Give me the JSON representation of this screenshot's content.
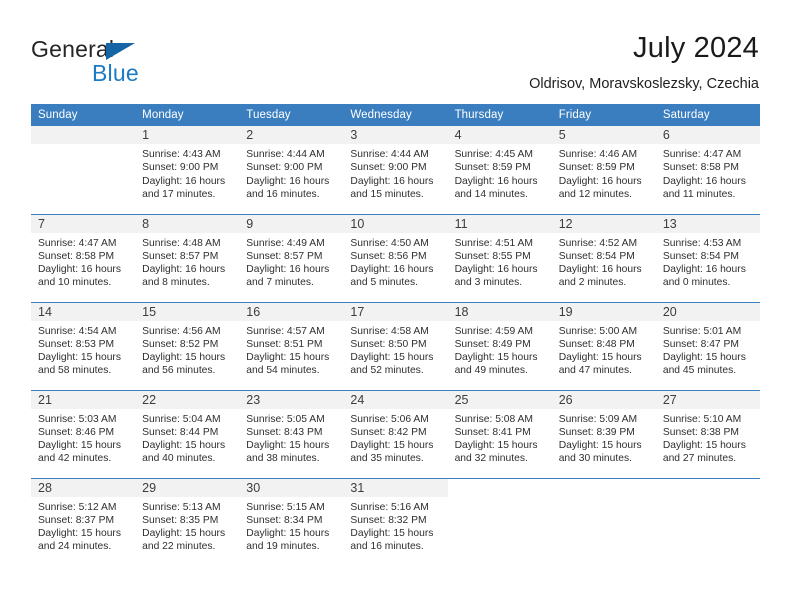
{
  "brand": {
    "word_one": "General",
    "word_two": "Blue",
    "triangle_color": "#1565a6",
    "blue_color": "#1d7bc4"
  },
  "header": {
    "title": "July 2024",
    "subtitle": "Oldrisov, Moravskoslezsky, Czechia"
  },
  "theme": {
    "header_bg": "#3a7ebf",
    "header_text": "#ffffff",
    "daynum_band_bg": "#f2f2f2",
    "row_divider": "#3a7ebf"
  },
  "weekdays": [
    "Sunday",
    "Monday",
    "Tuesday",
    "Wednesday",
    "Thursday",
    "Friday",
    "Saturday"
  ],
  "weeks": [
    [
      {
        "day": "",
        "lines": []
      },
      {
        "day": "1",
        "lines": [
          "Sunrise: 4:43 AM",
          "Sunset: 9:00 PM",
          "Daylight: 16 hours",
          "and 17 minutes."
        ]
      },
      {
        "day": "2",
        "lines": [
          "Sunrise: 4:44 AM",
          "Sunset: 9:00 PM",
          "Daylight: 16 hours",
          "and 16 minutes."
        ]
      },
      {
        "day": "3",
        "lines": [
          "Sunrise: 4:44 AM",
          "Sunset: 9:00 PM",
          "Daylight: 16 hours",
          "and 15 minutes."
        ]
      },
      {
        "day": "4",
        "lines": [
          "Sunrise: 4:45 AM",
          "Sunset: 8:59 PM",
          "Daylight: 16 hours",
          "and 14 minutes."
        ]
      },
      {
        "day": "5",
        "lines": [
          "Sunrise: 4:46 AM",
          "Sunset: 8:59 PM",
          "Daylight: 16 hours",
          "and 12 minutes."
        ]
      },
      {
        "day": "6",
        "lines": [
          "Sunrise: 4:47 AM",
          "Sunset: 8:58 PM",
          "Daylight: 16 hours",
          "and 11 minutes."
        ]
      }
    ],
    [
      {
        "day": "7",
        "lines": [
          "Sunrise: 4:47 AM",
          "Sunset: 8:58 PM",
          "Daylight: 16 hours",
          "and 10 minutes."
        ]
      },
      {
        "day": "8",
        "lines": [
          "Sunrise: 4:48 AM",
          "Sunset: 8:57 PM",
          "Daylight: 16 hours",
          "and 8 minutes."
        ]
      },
      {
        "day": "9",
        "lines": [
          "Sunrise: 4:49 AM",
          "Sunset: 8:57 PM",
          "Daylight: 16 hours",
          "and 7 minutes."
        ]
      },
      {
        "day": "10",
        "lines": [
          "Sunrise: 4:50 AM",
          "Sunset: 8:56 PM",
          "Daylight: 16 hours",
          "and 5 minutes."
        ]
      },
      {
        "day": "11",
        "lines": [
          "Sunrise: 4:51 AM",
          "Sunset: 8:55 PM",
          "Daylight: 16 hours",
          "and 3 minutes."
        ]
      },
      {
        "day": "12",
        "lines": [
          "Sunrise: 4:52 AM",
          "Sunset: 8:54 PM",
          "Daylight: 16 hours",
          "and 2 minutes."
        ]
      },
      {
        "day": "13",
        "lines": [
          "Sunrise: 4:53 AM",
          "Sunset: 8:54 PM",
          "Daylight: 16 hours",
          "and 0 minutes."
        ]
      }
    ],
    [
      {
        "day": "14",
        "lines": [
          "Sunrise: 4:54 AM",
          "Sunset: 8:53 PM",
          "Daylight: 15 hours",
          "and 58 minutes."
        ]
      },
      {
        "day": "15",
        "lines": [
          "Sunrise: 4:56 AM",
          "Sunset: 8:52 PM",
          "Daylight: 15 hours",
          "and 56 minutes."
        ]
      },
      {
        "day": "16",
        "lines": [
          "Sunrise: 4:57 AM",
          "Sunset: 8:51 PM",
          "Daylight: 15 hours",
          "and 54 minutes."
        ]
      },
      {
        "day": "17",
        "lines": [
          "Sunrise: 4:58 AM",
          "Sunset: 8:50 PM",
          "Daylight: 15 hours",
          "and 52 minutes."
        ]
      },
      {
        "day": "18",
        "lines": [
          "Sunrise: 4:59 AM",
          "Sunset: 8:49 PM",
          "Daylight: 15 hours",
          "and 49 minutes."
        ]
      },
      {
        "day": "19",
        "lines": [
          "Sunrise: 5:00 AM",
          "Sunset: 8:48 PM",
          "Daylight: 15 hours",
          "and 47 minutes."
        ]
      },
      {
        "day": "20",
        "lines": [
          "Sunrise: 5:01 AM",
          "Sunset: 8:47 PM",
          "Daylight: 15 hours",
          "and 45 minutes."
        ]
      }
    ],
    [
      {
        "day": "21",
        "lines": [
          "Sunrise: 5:03 AM",
          "Sunset: 8:46 PM",
          "Daylight: 15 hours",
          "and 42 minutes."
        ]
      },
      {
        "day": "22",
        "lines": [
          "Sunrise: 5:04 AM",
          "Sunset: 8:44 PM",
          "Daylight: 15 hours",
          "and 40 minutes."
        ]
      },
      {
        "day": "23",
        "lines": [
          "Sunrise: 5:05 AM",
          "Sunset: 8:43 PM",
          "Daylight: 15 hours",
          "and 38 minutes."
        ]
      },
      {
        "day": "24",
        "lines": [
          "Sunrise: 5:06 AM",
          "Sunset: 8:42 PM",
          "Daylight: 15 hours",
          "and 35 minutes."
        ]
      },
      {
        "day": "25",
        "lines": [
          "Sunrise: 5:08 AM",
          "Sunset: 8:41 PM",
          "Daylight: 15 hours",
          "and 32 minutes."
        ]
      },
      {
        "day": "26",
        "lines": [
          "Sunrise: 5:09 AM",
          "Sunset: 8:39 PM",
          "Daylight: 15 hours",
          "and 30 minutes."
        ]
      },
      {
        "day": "27",
        "lines": [
          "Sunrise: 5:10 AM",
          "Sunset: 8:38 PM",
          "Daylight: 15 hours",
          "and 27 minutes."
        ]
      }
    ],
    [
      {
        "day": "28",
        "lines": [
          "Sunrise: 5:12 AM",
          "Sunset: 8:37 PM",
          "Daylight: 15 hours",
          "and 24 minutes."
        ]
      },
      {
        "day": "29",
        "lines": [
          "Sunrise: 5:13 AM",
          "Sunset: 8:35 PM",
          "Daylight: 15 hours",
          "and 22 minutes."
        ]
      },
      {
        "day": "30",
        "lines": [
          "Sunrise: 5:15 AM",
          "Sunset: 8:34 PM",
          "Daylight: 15 hours",
          "and 19 minutes."
        ]
      },
      {
        "day": "31",
        "lines": [
          "Sunrise: 5:16 AM",
          "Sunset: 8:32 PM",
          "Daylight: 15 hours",
          "and 16 minutes."
        ]
      },
      {
        "day": "",
        "lines": []
      },
      {
        "day": "",
        "lines": []
      },
      {
        "day": "",
        "lines": []
      }
    ]
  ]
}
